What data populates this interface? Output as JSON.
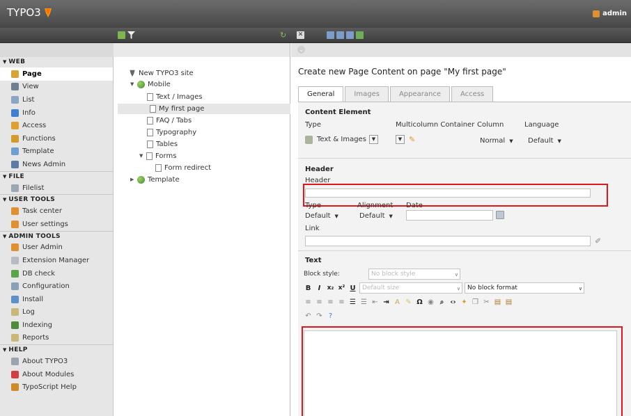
{
  "app": {
    "logo_text": "TYPO3",
    "user": "admin"
  },
  "modules": [
    {
      "section": "WEB",
      "items": [
        {
          "label": "Page",
          "icon": "page-icon",
          "color": "#d8a43a",
          "active": true
        },
        {
          "label": "View",
          "icon": "eye-icon",
          "color": "#6f7f8f"
        },
        {
          "label": "List",
          "icon": "list-icon",
          "color": "#8aa6c6"
        },
        {
          "label": "Info",
          "icon": "info-icon",
          "color": "#3f7fcf"
        },
        {
          "label": "Access",
          "icon": "lock-icon",
          "color": "#e0a030"
        },
        {
          "label": "Functions",
          "icon": "wrench-icon",
          "color": "#d49a2a"
        },
        {
          "label": "Template",
          "icon": "template-icon",
          "color": "#6f9fd0"
        },
        {
          "label": "News Admin",
          "icon": "news-icon",
          "color": "#5c7aa3"
        }
      ]
    },
    {
      "section": "FILE",
      "items": [
        {
          "label": "Filelist",
          "icon": "folder-icon",
          "color": "#9aa7b5"
        }
      ]
    },
    {
      "section": "USER TOOLS",
      "items": [
        {
          "label": "Task center",
          "icon": "user-icon",
          "color": "#e09030"
        },
        {
          "label": "User settings",
          "icon": "user-icon",
          "color": "#e09030"
        }
      ]
    },
    {
      "section": "ADMIN TOOLS",
      "items": [
        {
          "label": "User Admin",
          "icon": "user-icon",
          "color": "#e09030"
        },
        {
          "label": "Extension Manager",
          "icon": "extension-icon",
          "color": "#b6bcc2"
        },
        {
          "label": "DB check",
          "icon": "db-icon",
          "color": "#5aa34a"
        },
        {
          "label": "Configuration",
          "icon": "config-icon",
          "color": "#8aa0b6"
        },
        {
          "label": "Install",
          "icon": "install-icon",
          "color": "#5d8fc9"
        },
        {
          "label": "Log",
          "icon": "log-icon",
          "color": "#c9b87a"
        },
        {
          "label": "Indexing",
          "icon": "indexing-icon",
          "color": "#4f8c3a"
        },
        {
          "label": "Reports",
          "icon": "reports-icon",
          "color": "#c9b87a"
        }
      ]
    },
    {
      "section": "HELP",
      "items": [
        {
          "label": "About TYPO3",
          "icon": "about-icon",
          "color": "#9aa5b0"
        },
        {
          "label": "About Modules",
          "icon": "about-modules-icon",
          "color": "#d04040"
        },
        {
          "label": "TypoScript Help",
          "icon": "typoscript-icon",
          "color": "#d08a2a"
        }
      ]
    }
  ],
  "tree": {
    "root": "New TYPO3 site",
    "mobile": "Mobile",
    "pages": [
      "Text / Images",
      "My first page",
      "FAQ / Tabs",
      "Typography",
      "Tables",
      "Forms"
    ],
    "form_redirect": "Form redirect",
    "template": "Template"
  },
  "content": {
    "title": "Create new Page Content on page \"My first page\"",
    "tabs": [
      "General",
      "Images",
      "Appearance",
      "Access"
    ],
    "content_element": {
      "heading": "Content Element",
      "type_label": "Type",
      "type_value": "Text & Images",
      "multicolumn_label": "Multicolumn Container",
      "column_label": "Column",
      "column_value": "Normal",
      "language_label": "Language",
      "language_value": "Default"
    },
    "header_section": {
      "heading": "Header",
      "header_label": "Header",
      "header_value": "",
      "type_label": "Type",
      "type_value": "Default",
      "alignment_label": "Alignment",
      "alignment_value": "Default",
      "date_label": "Date",
      "link_label": "Link"
    },
    "text_section": {
      "heading": "Text",
      "block_style_label": "Block style:",
      "block_style_value": "No block style",
      "font_size_value": "Default size",
      "block_format_value": "No block format"
    }
  }
}
